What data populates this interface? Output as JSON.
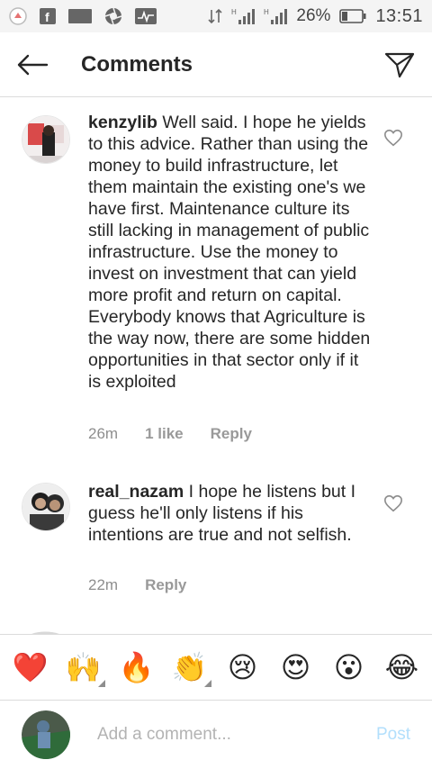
{
  "status_bar": {
    "time": "13:51",
    "battery": "26%",
    "icons": [
      "notification-icon",
      "facebook-icon",
      "screen-icon",
      "aperture-icon",
      "activity-icon",
      "data-arrows-icon",
      "signal-h-icon",
      "signal-h2-icon",
      "battery-icon"
    ]
  },
  "header": {
    "title": "Comments"
  },
  "comments": [
    {
      "username": "kenzylib",
      "text": "Well said. I hope he yields to this advice. Rather than using the money to build infrastructure, let them maintain the existing one's we have first. Maintenance culture its still lacking in management of public infrastructure. Use the money to invest on investment that can yield more profit and return on capital. Everybody knows that Agriculture is the way now, there are some hidden opportunities in that sector only if it is exploited",
      "time": "26m",
      "likes": "1 like",
      "reply": "Reply"
    },
    {
      "username": "real_nazam",
      "text": "I hope he listens but I guess he'll only listens if his intentions are true and not selfish.",
      "time": "22m",
      "likes": "",
      "reply": "Reply"
    }
  ],
  "emoji_bar": [
    {
      "glyph": "❤️",
      "name": "heart"
    },
    {
      "glyph": "🙌",
      "name": "raising-hands"
    },
    {
      "glyph": "🔥",
      "name": "fire"
    },
    {
      "glyph": "👏",
      "name": "clapping-hands"
    },
    {
      "glyph": "😢",
      "name": "crying-face"
    },
    {
      "glyph": "😍",
      "name": "heart-eyes"
    },
    {
      "glyph": "😮",
      "name": "surprised-face"
    },
    {
      "glyph": "😂",
      "name": "tears-of-joy"
    }
  ],
  "composer": {
    "placeholder": "Add a comment...",
    "post_label": "Post"
  },
  "colors": {
    "text": "#262626",
    "meta": "#8e8e8e",
    "divider": "#dbdbdb",
    "post_disabled": "#b2dffc",
    "heart": "#ed4956"
  }
}
